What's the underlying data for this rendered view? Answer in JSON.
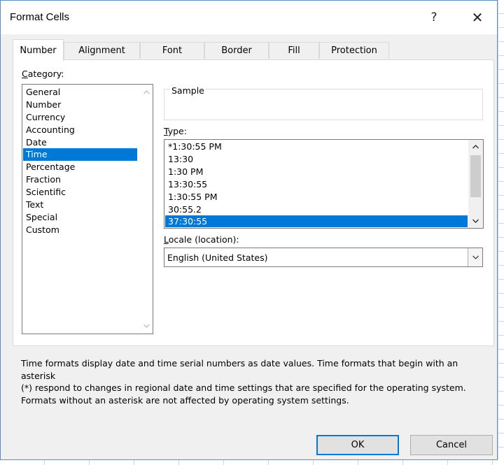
{
  "dialog": {
    "title": "Format Cells",
    "help_label": "?",
    "close_label": "✕"
  },
  "tabs": [
    {
      "label": "Number",
      "active": true
    },
    {
      "label": "Alignment",
      "active": false
    },
    {
      "label": "Font",
      "active": false
    },
    {
      "label": "Border",
      "active": false
    },
    {
      "label": "Fill",
      "active": false
    },
    {
      "label": "Protection",
      "active": false
    }
  ],
  "category": {
    "label_key": "C",
    "label_rest": "ategory:",
    "items": [
      "General",
      "Number",
      "Currency",
      "Accounting",
      "Date",
      "Time",
      "Percentage",
      "Fraction",
      "Scientific",
      "Text",
      "Special",
      "Custom"
    ],
    "selected": "Time"
  },
  "sample": {
    "label": "Sample",
    "value": ""
  },
  "type": {
    "label_key": "T",
    "label_rest": "ype:",
    "items": [
      "*1:30:55 PM",
      "13:30",
      "1:30 PM",
      "13:30:55",
      "1:30:55 PM",
      "30:55.2",
      "37:30:55"
    ],
    "selected": "37:30:55"
  },
  "locale": {
    "label_key": "L",
    "label_rest": "ocale (location):",
    "value": "English (United States)"
  },
  "description": [
    "Time formats display date and time serial numbers as date values.  Time formats that begin with an asterisk",
    "(*) respond to changes in regional date and time settings that are specified for the operating system.",
    "Formats without an asterisk are not affected by operating system settings."
  ],
  "buttons": {
    "ok": "OK",
    "cancel": "Cancel"
  },
  "icons": {
    "scroll_up": "chevron-up-icon",
    "scroll_down": "chevron-down-icon",
    "dropdown": "chevron-down-icon",
    "close": "close-icon",
    "help": "help-icon"
  },
  "colors": {
    "selection": "#0078d7",
    "dialog_bg": "#f0f0f0",
    "border_accent": "#5a8dc7"
  }
}
